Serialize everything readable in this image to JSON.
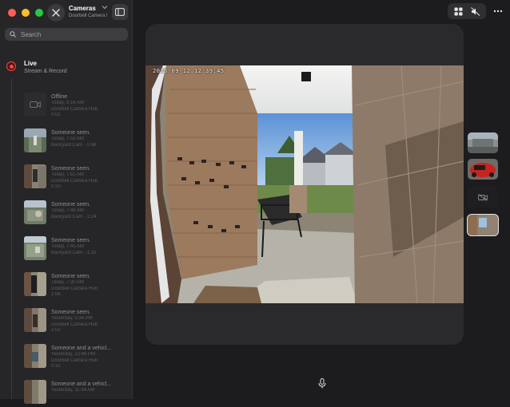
{
  "window": {
    "title": "Cameras",
    "subtitle": "Doorbell Camera Hub"
  },
  "search": {
    "placeholder": "Search"
  },
  "live": {
    "title": "Live",
    "subtitle": "Stream & Record"
  },
  "events": [
    {
      "title": "Offline",
      "time": "Today, 9:16 AM",
      "source": "Doorbell Camera Hub",
      "duration": "0:01",
      "thumb": "offline-icon"
    },
    {
      "title": "Someone seen.",
      "time": "Today, 7:53 AM",
      "source": "Backyard Cam",
      "duration": "0:48",
      "thumb": "backyard"
    },
    {
      "title": "Someone seen.",
      "time": "Today, 7:51 AM",
      "source": "Doorbell Camera Hub",
      "duration": "0:20",
      "thumb": "porch"
    },
    {
      "title": "Someone seen.",
      "time": "Today, 7:49 AM",
      "source": "Backyard Cam",
      "duration": "2:24",
      "thumb": "backyard"
    },
    {
      "title": "Someone seen.",
      "time": "Today, 7:45 AM",
      "source": "Backyard Cam",
      "duration": "1:20",
      "thumb": "backyard"
    },
    {
      "title": "Someone seen.",
      "time": "Today, 7:30 AM",
      "source": "Doorbell Camera Hub",
      "duration": "1:06",
      "thumb": "porch"
    },
    {
      "title": "Someone seen.",
      "time": "Yesterday, 5:34 PM",
      "source": "Doorbell Camera Hub",
      "duration": "1:02",
      "thumb": "porch"
    },
    {
      "title": "Someone and a vehicl...",
      "time": "Yesterday, 12:49 PM",
      "source": "Doorbell Camera Hub",
      "duration": "0:32",
      "thumb": "porch"
    },
    {
      "title": "Someone and a vehicl...",
      "time": "Yesterday, 11:34 AM",
      "source": "",
      "duration": "",
      "thumb": "porch"
    }
  ],
  "video": {
    "timestamp": "2026-09-12 12:39:45"
  },
  "toolbar": {
    "layout_icon": "grid-icon",
    "mute_icon": "speaker-muted-icon",
    "more_icon": "ellipsis-icon"
  },
  "camera_thumbs": [
    {
      "name": "street-view"
    },
    {
      "name": "red-car-view"
    },
    {
      "name": "offline-camera"
    },
    {
      "name": "doorbell-view",
      "selected": true
    }
  ],
  "colors": {
    "accent_live": "#ff453a",
    "background": "#1c1c1e",
    "sidebar": "#262628"
  }
}
